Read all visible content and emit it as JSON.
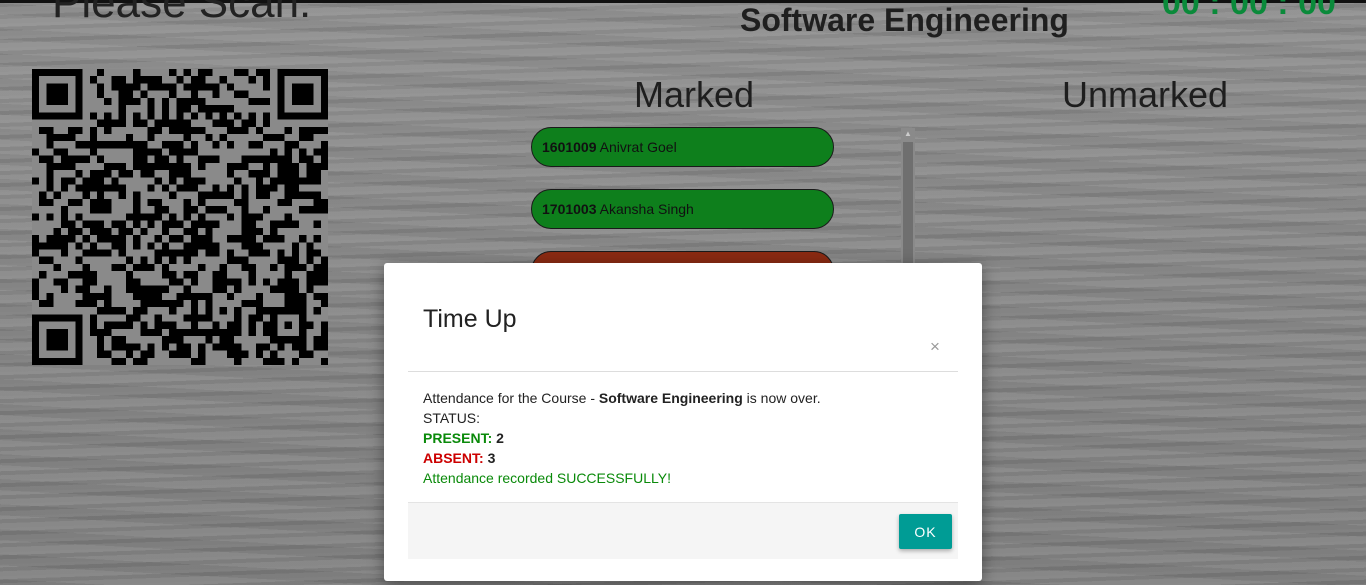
{
  "header": {
    "please_scan": "Please Scan:",
    "course_title": "Software Engineering",
    "timer": "00 : 00 : 00"
  },
  "columns": {
    "marked": "Marked",
    "unmarked": "Unmarked"
  },
  "marked_students": [
    {
      "id": "1601009",
      "name": "Anivrat Goel",
      "status": "green"
    },
    {
      "id": "1701003",
      "name": "Akansha Singh",
      "status": "green"
    },
    {
      "id": "",
      "name": "",
      "status": "red"
    }
  ],
  "modal": {
    "title": "Time Up",
    "close_glyph": "×",
    "line1_prefix": "Attendance for the Course - ",
    "line1_course": "Software Engineering",
    "line1_suffix": " is now over.",
    "status_label": "STATUS:",
    "present_label": "PRESENT:",
    "present_count": "2",
    "absent_label": "ABSENT:",
    "absent_count": "3",
    "success_message": "Attendance recorded SUCCESSFULLY!",
    "ok_label": "OK"
  },
  "colors": {
    "present": "#0a8a0a",
    "absent": "#cc0000",
    "ok_button": "#009c95",
    "timer": "#0a8a3a"
  },
  "icons": {
    "qr": "qr-code",
    "close": "close-icon"
  }
}
